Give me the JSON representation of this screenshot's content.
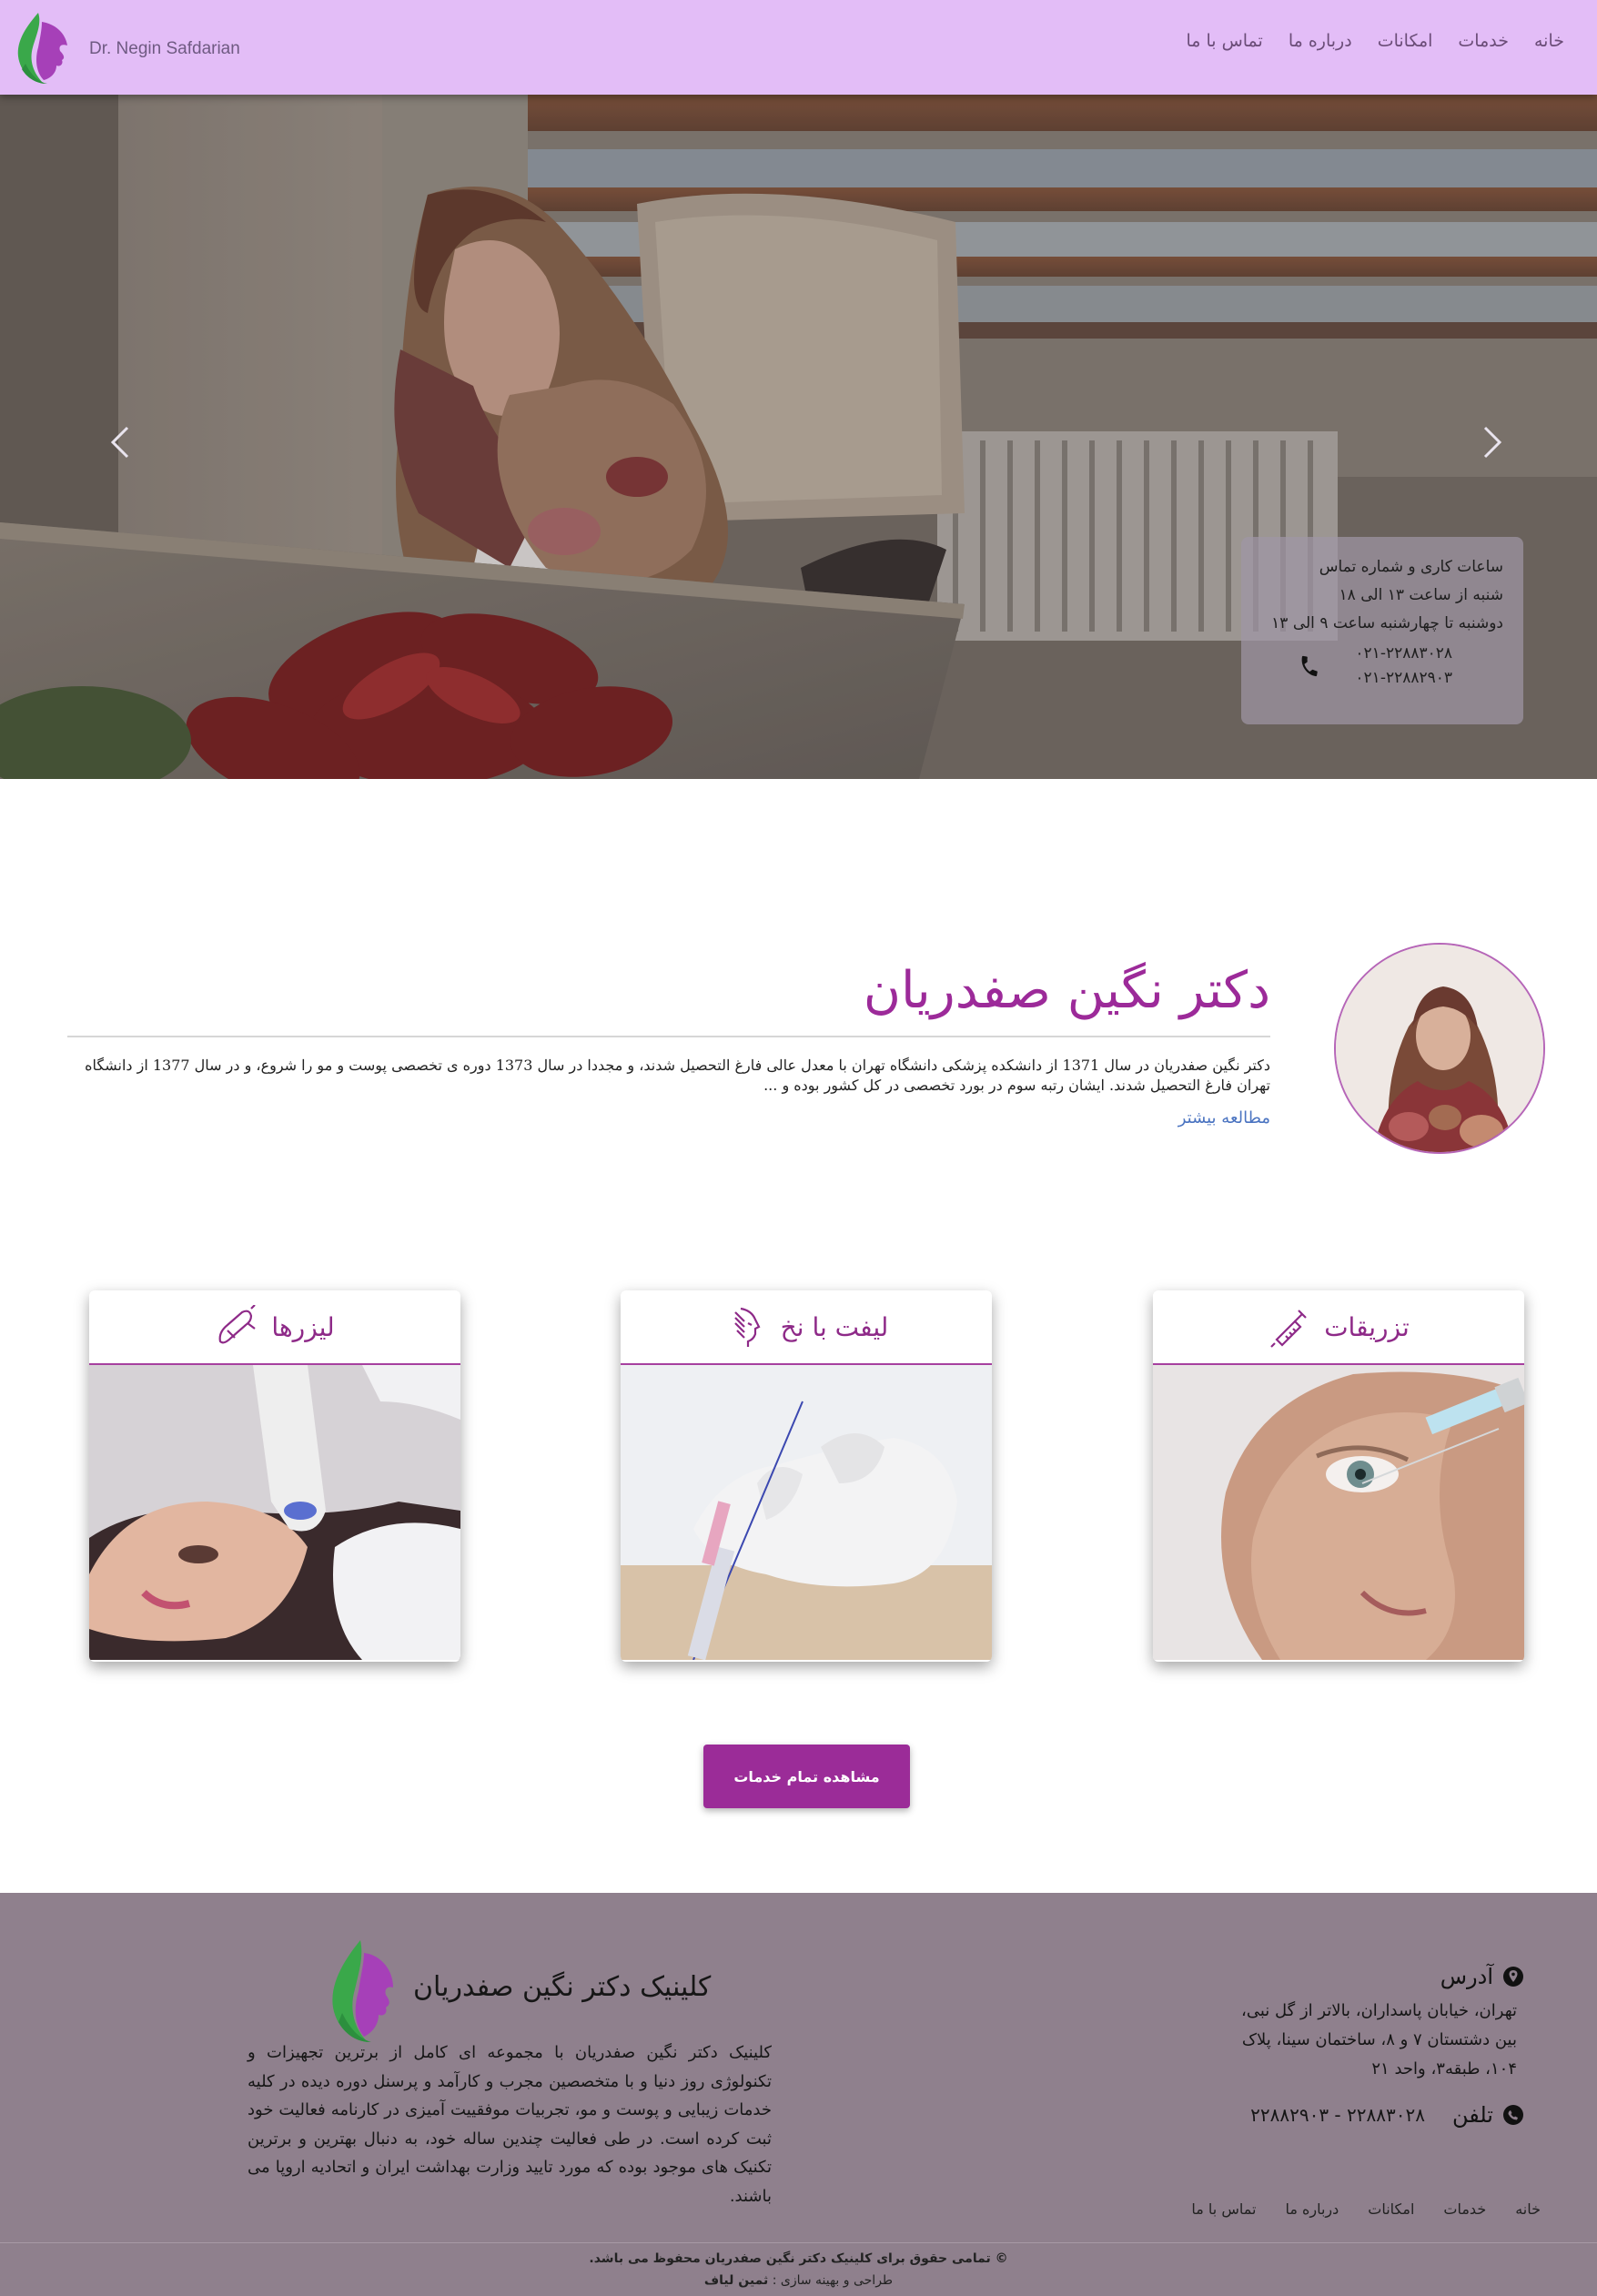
{
  "navbar": {
    "brand": "Dr. Negin Safdarian",
    "items": [
      "خانه",
      "خدمات",
      "امکانات",
      "درباره ما",
      "تماس با ما"
    ]
  },
  "hero": {
    "hours_title": "ساعات کاری و شماره تماس",
    "hours_line1": "شنبه از ساعت ۱۳ الی ۱۸",
    "hours_line2": "دوشنبه تا چهارشنبه ساعت ۹ الی ۱۳",
    "phone1": "۰۲۱-۲۲۸۸۳۰۲۸",
    "phone2": "۰۲۱-۲۲۸۸۲۹۰۳"
  },
  "about": {
    "title": "دکتر نگین صفدریان",
    "text": "دکتر نگین صفدریان در سال 1371 از دانشکده پزشکی دانشگاه تهران با معدل عالی فارغ التحصیل شدند، و مجددا در سال 1373 دوره ی تخصصی پوست و مو را شروع، و در سال 1377 از دانشگاه تهران فارغ التحصیل شدند. ایشان رتبه سوم در بورد تخصصی در کل کشور بوده و ...",
    "read_more": "مطالعه بیشتر"
  },
  "services": {
    "cards": [
      {
        "title": "تزریقات",
        "icon": "syringe-icon"
      },
      {
        "title": "لیفت با نخ",
        "icon": "face-thread-icon"
      },
      {
        "title": "لیزرها",
        "icon": "laser-icon"
      }
    ],
    "all_button": "مشاهده تمام خدمات"
  },
  "footer": {
    "address_title": "آدرس",
    "address_text": "تهران، خیابان پاسداران، بالاتر از گل نبی، بین دشتستان ۷ و ۸، ساختمان سینا، پلاک ۱۰۴، طبقه۳، واحد ۲۱",
    "phone_title": "تلفن",
    "phone_text": "۲۲۸۸۳۰۲۸ - ۲۲۸۸۲۹۰۳",
    "clinic_title": "کلینیک دکتر نگین صفدریان",
    "clinic_desc": "کلینیک دکتر نگین صفدریان با مجموعه ای کامل از برترین تجهیزات و تکنولوژی روز دنیا و با متخصصین مجرب و کارآمد و پرسنل دوره دیده در کلیه خدمات زیبایی و پوست و مو، تجربیات موفقییت آمیزی در کارنامه فعالیت خود ثبت کرده است. در طی فعالیت چندین ساله خود، به دنبال بهترین و برترین تکنیک های موجود بوده که مورد تایید وزارت بهداشت ایران و اتحادیه اروپا می باشند.",
    "nav": [
      "خانه",
      "خدمات",
      "امکانات",
      "درباره ما",
      "تماس با ما"
    ],
    "copyright": "© تمامی حقوق برای کلینیک دکتر نگین صفدریان محفوظ می باشد.",
    "credit_prefix": "طراحی و بهینه سازی :",
    "credit_name": "ثمین لیاف"
  },
  "colors": {
    "navbar_bg": "#e3bdf7",
    "accent": "#9b2c98",
    "link": "#4b74c1",
    "footer_bg": "#8f808d"
  }
}
